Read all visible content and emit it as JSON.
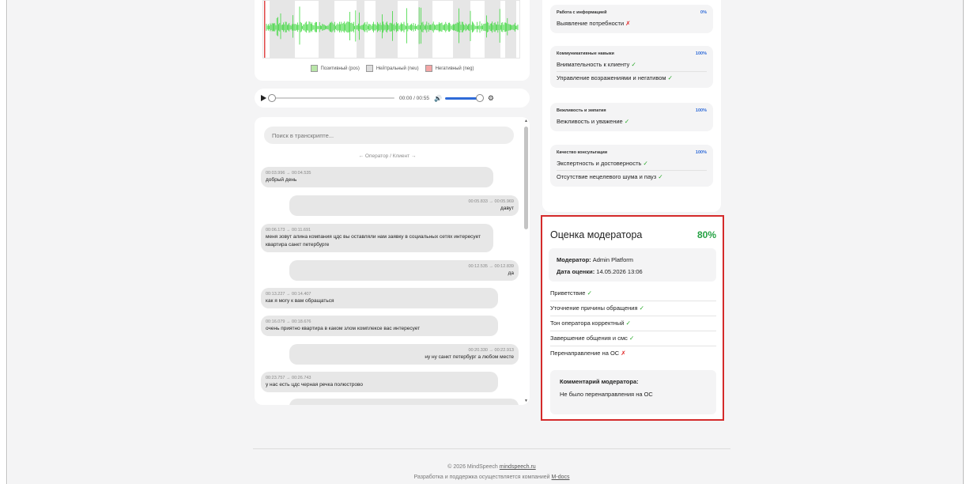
{
  "legend": {
    "positive": "Позитивный (pos)",
    "neutral": "Нейтральный (neu)",
    "negative": "Негативный (neg)",
    "colors": {
      "positive": "#b9e6a8",
      "neutral": "#dddddd",
      "negative": "#f4a6a6"
    }
  },
  "player": {
    "time": "00:00 / 00:55",
    "progress": 0.0,
    "volume": 1.0,
    "icons": [
      "play-icon",
      "volume-icon",
      "gear-icon"
    ]
  },
  "transcript": {
    "search_placeholder": "Поиск в транскрипте...",
    "direction": "← Оператор / Клиент →",
    "messages": [
      {
        "side": "left",
        "ts": "00:03.996 → 00:04.535",
        "text": "добрый день"
      },
      {
        "side": "right",
        "ts": "00:05.833 → 00:05.969",
        "text": "давут"
      },
      {
        "side": "left",
        "ts": "00:06.173 → 00:11.691",
        "text": "меня зовут алина компания цдс вы оставляли нам заявку в социальных сетях интересует квартира санкт петербурге"
      },
      {
        "side": "right",
        "ts": "00:12.535 → 00:12.839",
        "text": "да"
      },
      {
        "side": "left",
        "ts": "00:13.227 → 00:14.407",
        "text": "как я могу к вам обращаться"
      },
      {
        "side": "left",
        "ts": "00:16.079 → 00:18.676",
        "text": "очень приятно квартира в каком злом комплексе вас интересует"
      },
      {
        "side": "right",
        "ts": "00:20.330 → 00:22.913",
        "text": "ну ну санкт петербург а любом месте"
      },
      {
        "side": "left",
        "ts": "00:23.757 → 00:26.743",
        "text": "у нас есть цдс черная речка полюстрово"
      }
    ]
  },
  "criteria": [
    {
      "title": "Работа с информацией",
      "pct": "0%",
      "items": [
        {
          "label": "Выявление потребности",
          "mark": "✗"
        }
      ]
    },
    {
      "title": "Коммуникативные навыки",
      "pct": "100%",
      "items": [
        {
          "label": "Внимательность к клиенту",
          "mark": "✓"
        },
        {
          "label": "Управление возражениями и негативом",
          "mark": "✓"
        }
      ]
    },
    {
      "title": "Вежливость и эмпатия",
      "pct": "100%",
      "items": [
        {
          "label": "Вежливость и уважение",
          "mark": "✓"
        }
      ]
    },
    {
      "title": "Качество консультации",
      "pct": "100%",
      "items": [
        {
          "label": "Экспертность и достоверность",
          "mark": "✓"
        },
        {
          "label": "Отсутствие нецелевого шума и пауз",
          "mark": "✓"
        }
      ]
    }
  ],
  "moderator": {
    "title": "Оценка модератора",
    "score": "80%",
    "moderator_label": "Модератор:",
    "moderator_name": "Admin Platform",
    "date_label": "Дата оценки:",
    "date_value": "14.05.2026 13:06",
    "items": [
      {
        "label": "Приветствие",
        "mark": "✓"
      },
      {
        "label": "Уточнение причины обращения",
        "mark": "✓"
      },
      {
        "label": "Тон оператора корректный",
        "mark": "✓"
      },
      {
        "label": "Завершение общения и смс",
        "mark": "✓"
      },
      {
        "label": "Перенаправление на ОС",
        "mark": "✗"
      }
    ],
    "comment_label": "Комментарий модератора:",
    "comment_text": "Не было перенаправления на ОС"
  },
  "footer": {
    "line1_prefix": "© 2026 MindSpeech ",
    "line1_link": "mindspeech.ru",
    "line2_prefix": "Разработка и поддержка осуществляется компанией ",
    "line2_link": "M-docs"
  }
}
